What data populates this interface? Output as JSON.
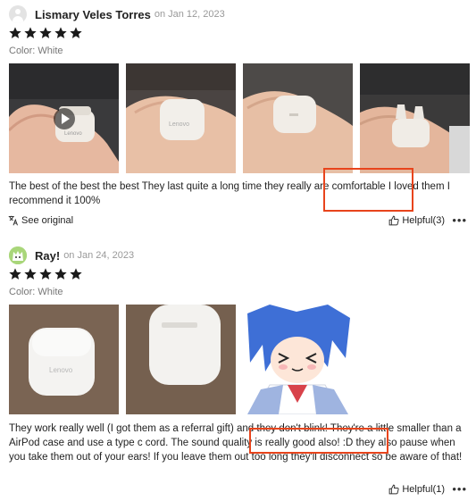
{
  "reviews": [
    {
      "reviewer": "Lismary Veles Torres",
      "date": "on Jan 12, 2023",
      "rating": 5,
      "color": "Color: White",
      "text": "The best of the best the best They last quite a long time they really are comfortable I loved them I recommend it 100%",
      "see_original": "See original",
      "helpful": "Helpful(3)",
      "more": "•••"
    },
    {
      "reviewer": "Ray!",
      "date": "on Jan 24, 2023",
      "rating": 5,
      "color": "Color: White",
      "text": "They work really well (I got them as a referral gift) and they don't blink! They're a little smaller than a AirPod case and use a type c cord. The sound quality is really good also! :D they also pause when you take them out of your ears! If you leave them out too long they'll disconnect so be aware of that!",
      "helpful": "Helpful(1)",
      "more": "•••"
    }
  ],
  "colors": {
    "star": "#1a1a1a",
    "highlight": "#e8441c"
  }
}
